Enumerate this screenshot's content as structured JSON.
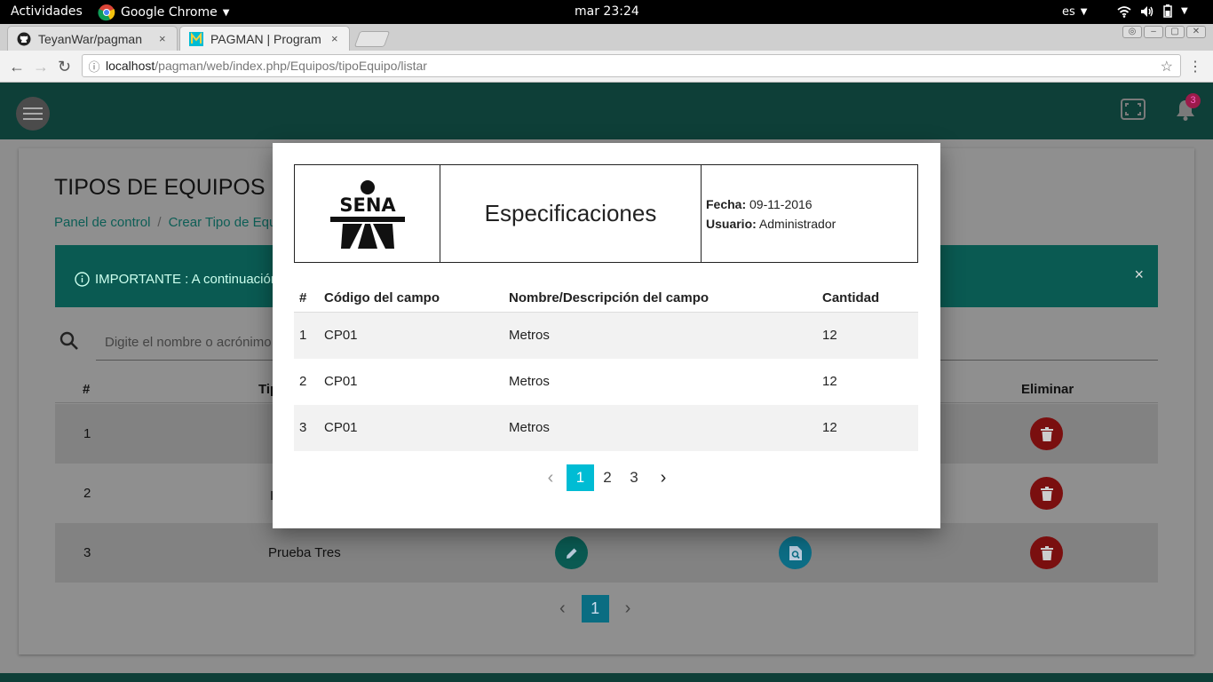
{
  "os": {
    "activities": "Actividades",
    "app_name": "Google Chrome",
    "clock": "mar 23:24",
    "lang": "es"
  },
  "browser": {
    "tabs": [
      {
        "title": "TeyanWar/pagman",
        "close": "×"
      },
      {
        "title": "PAGMAN | Program",
        "close": "×"
      }
    ],
    "url_host": "localhost",
    "url_path": "/pagman/web/index.php/Equipos/tipoEquipo/listar"
  },
  "app": {
    "notification_count": "3"
  },
  "page": {
    "title": "TIPOS DE EQUIPOS",
    "breadcrumbs": [
      "Panel de control",
      "Crear Tipo de Equ"
    ],
    "alert": "IMPORTANTE : A continuación",
    "search_placeholder": "Digite el nombre o acrónimo",
    "headers": {
      "num": "#",
      "type": "Tip",
      "delete": "Eliminar"
    },
    "rows": [
      {
        "num": "1",
        "name": ""
      },
      {
        "num": "2",
        "name": "I"
      },
      {
        "num": "3",
        "name": "Prueba Tres"
      }
    ],
    "pagination": {
      "current": "1"
    }
  },
  "modal": {
    "logo_text": "SENA",
    "title": "Especificaciones",
    "fecha_label": "Fecha:",
    "fecha": "09-11-2016",
    "usuario_label": "Usuario:",
    "usuario": "Administrador",
    "headers": [
      "#",
      "Código del campo",
      "Nombre/Descripción del campo",
      "Cantidad"
    ],
    "rows": [
      [
        "1",
        "CP01",
        "Metros",
        "12"
      ],
      [
        "2",
        "CP01",
        "Metros",
        "12"
      ],
      [
        "3",
        "CP01",
        "Metros",
        "12"
      ]
    ],
    "pages": [
      "1",
      "2",
      "3"
    ]
  }
}
